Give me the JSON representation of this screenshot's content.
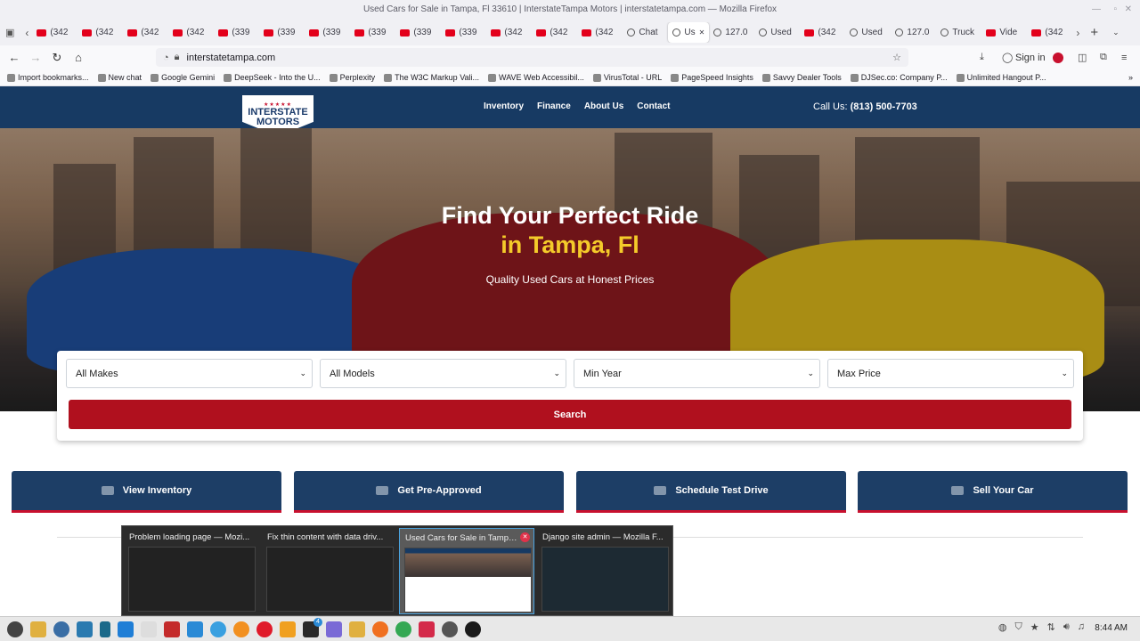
{
  "browser": {
    "title": "Used Cars for Sale in Tampa, Fl 33610 | InterstateTampa Motors | interstatetampa.com — Mozilla Firefox",
    "tabs": [
      {
        "label": "(342",
        "icon": "youtube-icon"
      },
      {
        "label": "(342",
        "icon": "youtube-icon"
      },
      {
        "label": "(342",
        "icon": "youtube-icon"
      },
      {
        "label": "(342",
        "icon": "youtube-icon"
      },
      {
        "label": "(339",
        "icon": "youtube-icon"
      },
      {
        "label": "(339",
        "icon": "youtube-icon"
      },
      {
        "label": "(339",
        "icon": "youtube-icon"
      },
      {
        "label": "(339",
        "icon": "youtube-icon"
      },
      {
        "label": "(339",
        "icon": "youtube-icon"
      },
      {
        "label": "(339",
        "icon": "youtube-icon"
      },
      {
        "label": "(342",
        "icon": "youtube-icon"
      },
      {
        "label": "(342",
        "icon": "youtube-icon"
      },
      {
        "label": "(342",
        "icon": "youtube-icon"
      },
      {
        "label": "Chat",
        "icon": "globe-icon"
      },
      {
        "label": "Us",
        "icon": "globe-icon",
        "active": true
      },
      {
        "label": "127.0",
        "icon": "globe-icon"
      },
      {
        "label": "Used",
        "icon": "globe-icon"
      },
      {
        "label": "(342",
        "icon": "youtube-icon"
      },
      {
        "label": "Used",
        "icon": "globe-icon"
      },
      {
        "label": "127.0",
        "icon": "globe-icon"
      },
      {
        "label": "Truck",
        "icon": "globe-icon"
      },
      {
        "label": "Vide",
        "icon": "youtube-icon"
      },
      {
        "label": "(342",
        "icon": "youtube-icon"
      }
    ],
    "url": "interstatetampa.com",
    "sign_in": "Sign in",
    "bookmarks": [
      "Import bookmarks...",
      "New chat",
      "Google Gemini",
      "DeepSeek - Into the U...",
      "Perplexity",
      "The W3C Markup Vali...",
      "WAVE Web Accessibil...",
      "VirusTotal - URL",
      "PageSpeed Insights",
      "Savvy Dealer Tools",
      "DJSec.co: Company P...",
      "Unlimited Hangout P..."
    ]
  },
  "site": {
    "logo_line1": "INTERSTATE",
    "logo_line2": "MOTORS",
    "logo_stars": "★★★★★",
    "nav": [
      "Inventory",
      "Finance",
      "About Us",
      "Contact"
    ],
    "call_label": "Call Us:",
    "call_number": "(813) 500-7703",
    "hero_line1": "Find Your Perfect Ride",
    "hero_line2": "in Tampa, Fl",
    "hero_tagline": "Quality Used Cars at Honest Prices",
    "filters": [
      "All Makes",
      "All Models",
      "Min Year",
      "Max Price"
    ],
    "search_label": "Search",
    "quick_actions": [
      "View Inventory",
      "Get Pre-Approved",
      "Schedule Test Drive",
      "Sell Your Car"
    ]
  },
  "switcher": [
    {
      "title": "Problem loading page — Mozi..."
    },
    {
      "title": "Fix thin content with data driv..."
    },
    {
      "title": "Used Cars for Sale in Tampa, Fl...",
      "selected": true
    },
    {
      "title": "Django site admin — Mozilla F..."
    }
  ],
  "taskbar": {
    "clock": "8:44 AM",
    "badge": "4"
  }
}
